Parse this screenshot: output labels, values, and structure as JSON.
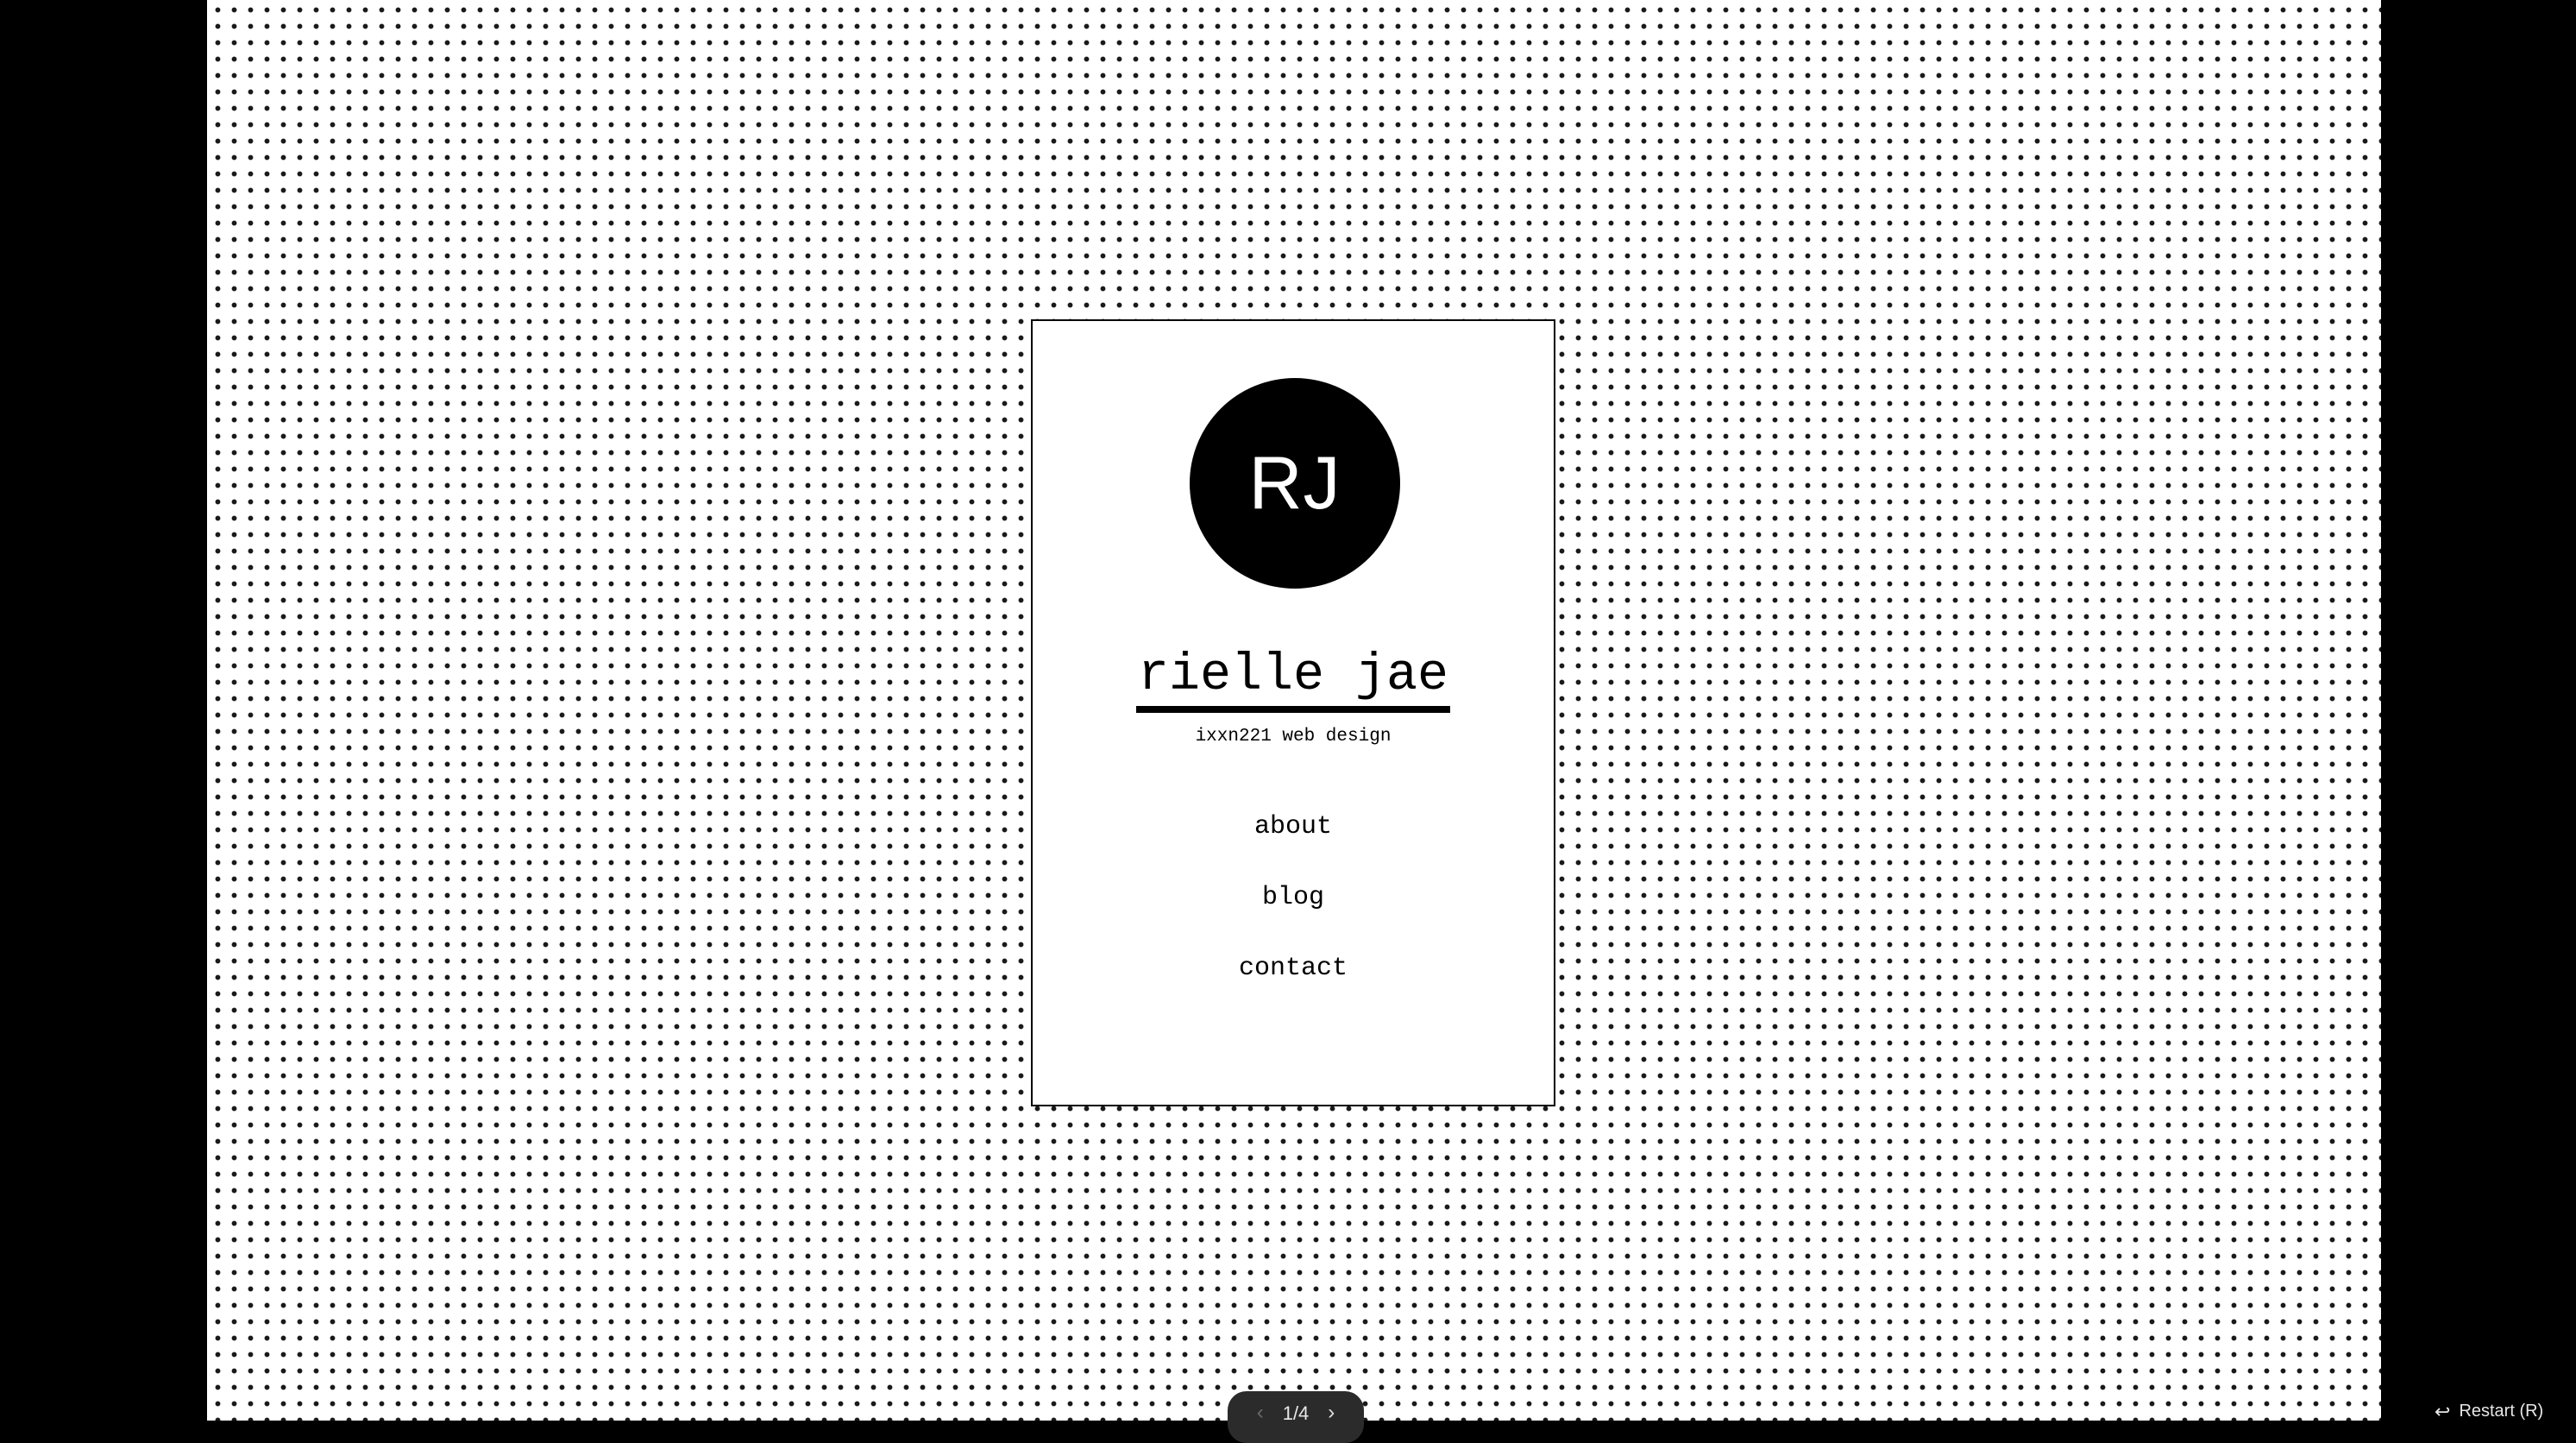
{
  "card": {
    "avatar_initials": "RJ",
    "title": "rielle jae",
    "subtitle": "ixxn221 web design"
  },
  "nav": {
    "items": [
      {
        "label": "about"
      },
      {
        "label": "blog"
      },
      {
        "label": "contact"
      }
    ]
  },
  "player": {
    "prev_icon": "chevron-left-icon",
    "next_icon": "chevron-right-icon",
    "page_indicator": "1/4",
    "restart_icon": "restart-icon",
    "restart_label": "Restart (R)"
  },
  "colors": {
    "background": "#ffffff",
    "dots": "#1a1a1a",
    "ink": "#000000",
    "letterbox": "#000000"
  }
}
